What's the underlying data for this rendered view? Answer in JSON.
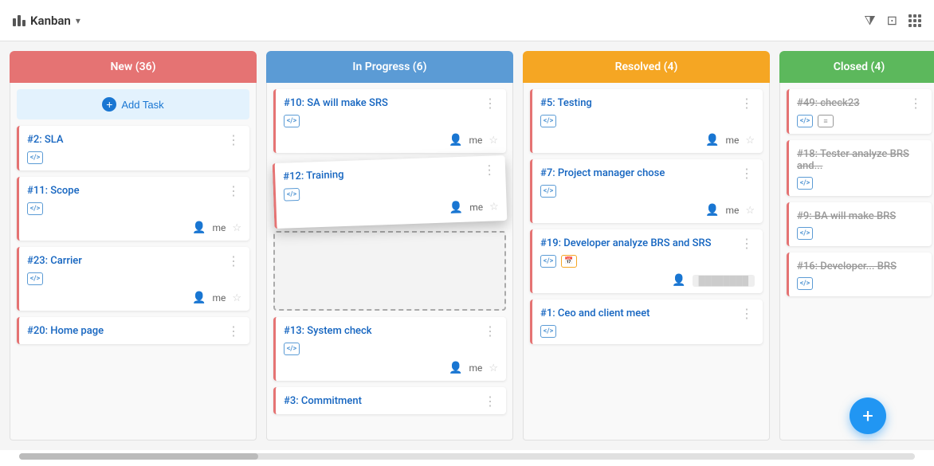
{
  "header": {
    "title": "Kanban",
    "chevron": "▾"
  },
  "columns": [
    {
      "id": "new",
      "label": "New (36)",
      "colorClass": "new",
      "cards": [
        {
          "id": "add-task",
          "type": "add-task",
          "label": "Add Task"
        },
        {
          "id": "c2",
          "number": "#2",
          "title": "SLA",
          "borderColor": "#e57373",
          "tags": [
            "code"
          ],
          "footer": {}
        },
        {
          "id": "c11",
          "number": "#11",
          "title": "Scope",
          "borderColor": "#e57373",
          "tags": [
            "code"
          ],
          "footer": {
            "assignee": "me",
            "star": true
          }
        },
        {
          "id": "c23",
          "number": "#23",
          "title": "Carrier",
          "borderColor": "#e57373",
          "tags": [
            "code"
          ],
          "footer": {
            "assignee": "me",
            "star": true
          }
        },
        {
          "id": "c20",
          "number": "#20",
          "title": "Home page",
          "borderColor": "#e57373",
          "tags": [],
          "footer": {}
        }
      ]
    },
    {
      "id": "in-progress",
      "label": "In Progress (6)",
      "colorClass": "in-progress",
      "cards": [
        {
          "id": "c10",
          "number": "#10",
          "title": "SA will make SRS",
          "borderColor": "#e57373",
          "tags": [
            "code"
          ],
          "footer": {
            "assignee": "me",
            "star": true
          }
        },
        {
          "id": "c12-drag",
          "number": "#12",
          "title": "Training",
          "borderColor": "#e57373",
          "tags": [
            "code"
          ],
          "type": "dragging",
          "footer": {
            "assignee": "me",
            "star": true
          }
        },
        {
          "id": "drop-zone",
          "type": "drop-zone"
        },
        {
          "id": "c13",
          "number": "#13",
          "title": "System check",
          "borderColor": "#e57373",
          "tags": [
            "code"
          ],
          "footer": {
            "assignee": "me",
            "star": true
          }
        },
        {
          "id": "c3",
          "number": "#3",
          "title": "Commitment",
          "borderColor": "#e57373",
          "tags": [],
          "footer": {}
        }
      ]
    },
    {
      "id": "resolved",
      "label": "Resolved (4)",
      "colorClass": "resolved",
      "cards": [
        {
          "id": "c5",
          "number": "#5",
          "title": "Testing",
          "borderColor": "#e57373",
          "tags": [
            "code"
          ],
          "footer": {
            "assignee": "me",
            "star": true
          }
        },
        {
          "id": "c7",
          "number": "#7",
          "title": "Project manager chose",
          "borderColor": "#e57373",
          "tags": [
            "code"
          ],
          "footer": {}
        },
        {
          "id": "c19",
          "number": "#19",
          "title": "Developer analyze BRS and SRS",
          "borderColor": "#e57373",
          "tags": [
            "code",
            "cal"
          ],
          "footer": {
            "assigneeBlur": true
          }
        },
        {
          "id": "c1",
          "number": "#1",
          "title": "Ceo and client meet",
          "borderColor": "#e57373",
          "tags": [
            "code"
          ],
          "footer": {}
        }
      ]
    },
    {
      "id": "closed",
      "label": "Closed (4)",
      "colorClass": "closed",
      "cards": [
        {
          "id": "c49",
          "number": "#49",
          "title": "check23",
          "borderColor": "#e57373",
          "tags": [
            "code",
            "list"
          ],
          "strikethrough": true,
          "footer": {}
        },
        {
          "id": "c18",
          "number": "#18",
          "title": "Tester analyze BRS and...",
          "borderColor": "#e57373",
          "tags": [
            "code"
          ],
          "strikethrough": true,
          "footer": {}
        },
        {
          "id": "c9",
          "number": "#9",
          "title": "BA will make BRS",
          "borderColor": "#e57373",
          "tags": [
            "code"
          ],
          "strikethrough": true,
          "footer": {}
        },
        {
          "id": "c16",
          "number": "#16",
          "title": "Developer... BRS",
          "borderColor": "#e57373",
          "tags": [
            "code"
          ],
          "strikethrough": true,
          "footer": {}
        }
      ]
    }
  ],
  "fab": {
    "label": "+"
  }
}
